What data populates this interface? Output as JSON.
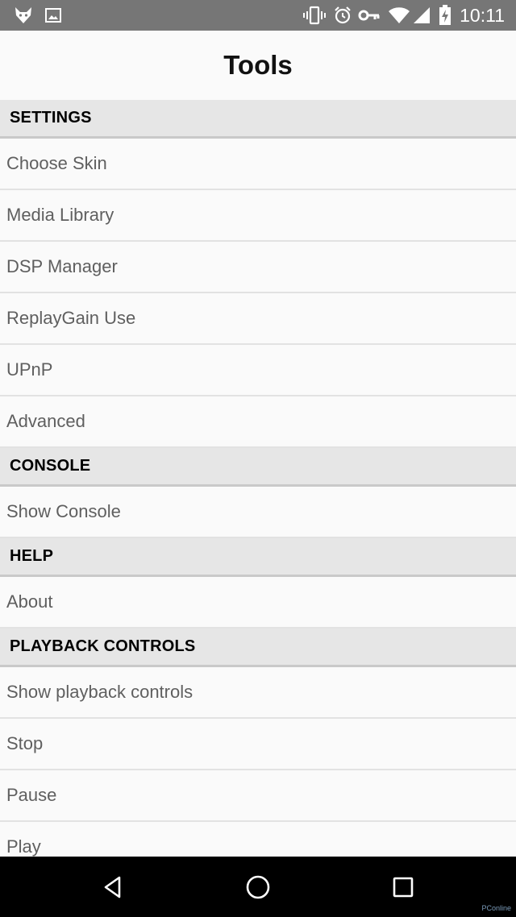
{
  "status_bar": {
    "time": "10:11",
    "icons": [
      "fox-app-icon",
      "image-icon",
      "vibrate-icon",
      "alarm-icon",
      "key-icon",
      "wifi-icon",
      "signal-icon",
      "battery-charging-icon"
    ]
  },
  "header": {
    "title": "Tools"
  },
  "sections": [
    {
      "header": "SETTINGS",
      "items": [
        "Choose Skin",
        "Media Library",
        "DSP Manager",
        "ReplayGain Use",
        "UPnP",
        "Advanced"
      ]
    },
    {
      "header": "CONSOLE",
      "items": [
        "Show Console"
      ]
    },
    {
      "header": "HELP",
      "items": [
        "About"
      ]
    },
    {
      "header": "PLAYBACK CONTROLS",
      "items": [
        "Show playback controls",
        "Stop",
        "Pause",
        "Play"
      ]
    }
  ],
  "nav_bar": {
    "buttons": [
      "back-icon",
      "home-icon",
      "recents-icon"
    ]
  },
  "watermark": "PConline"
}
